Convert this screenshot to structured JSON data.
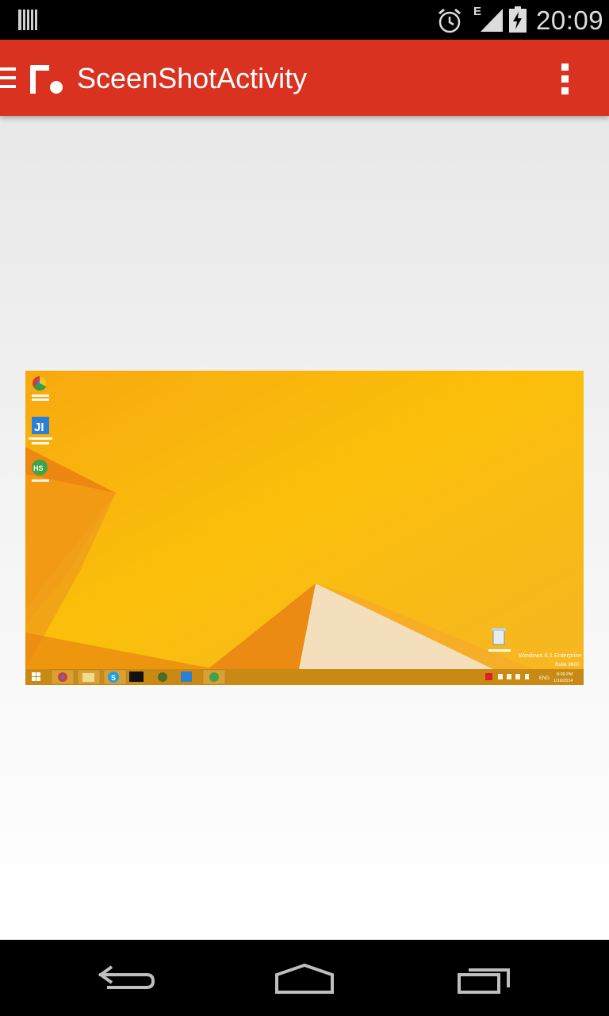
{
  "status_bar": {
    "time": "20:09",
    "network_type": "E",
    "icons": [
      "notification-icon",
      "alarm-icon",
      "signal-icon",
      "battery-charging-icon"
    ]
  },
  "toolbar": {
    "title": "SceenShotActivity",
    "icons": [
      "menu-icon",
      "app-logo",
      "overflow-menu-icon"
    ]
  },
  "content": {
    "image": {
      "desktop_icons": [
        "Google Chrome",
        "IntelliJ IDEA",
        "HS"
      ],
      "recycle_bin_label": "Recycle Bin",
      "watermark_line1": "Windows 8.1 Enterprise",
      "watermark_line2": "Build 9600",
      "taskbar_language": "ENG",
      "taskbar_time": "8:09 PM",
      "taskbar_date": "1/16/2014",
      "colors": {
        "wallpaper": "#f7b20f",
        "wallpaper_dark": "#e8750a",
        "taskbar": "#c98a14"
      }
    }
  },
  "navigation_bar": {
    "buttons": [
      "back-icon",
      "home-icon",
      "recents-icon"
    ]
  },
  "colors": {
    "toolbar": "#d93220",
    "status_bar": "#000000",
    "content_background": "#ededed"
  }
}
